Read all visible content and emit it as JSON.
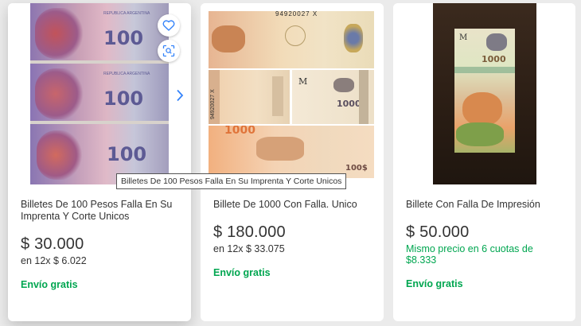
{
  "listings": [
    {
      "title": "Billetes De 100 Pesos Falla En Su Imprenta Y Corte Unicos",
      "price": "$ 30.000",
      "installments": "en 12x $ 6.022",
      "shipping": "Envío gratis",
      "image_text": {
        "note_value": "100",
        "bank_label": "REPUBLICA ARGENTINA"
      }
    },
    {
      "title": "Billete De 1000 Con Falla. Unico",
      "price": "$ 180.000",
      "installments": "en 12x $ 33.075",
      "shipping": "Envío gratis",
      "image_text": {
        "serial": "94920027 X",
        "serial_vertical": "94920027 X",
        "note_letter": "M",
        "note_value_a": "1000",
        "note_value_b": "1000",
        "note_value_c": "100$"
      }
    },
    {
      "title": "Billete Con Falla De Impresión",
      "price": "$ 50.000",
      "installments": "Mismo precio en 6 cuotas de $8.333",
      "shipping": "Envío gratis",
      "image_text": {
        "note_letter": "M",
        "note_value": "1000"
      }
    }
  ],
  "tooltip": "Billetes De 100 Pesos Falla En Su Imprenta Y Corte Unicos",
  "icons": {
    "favorite": "heart-icon",
    "visual_search": "visual-search-icon",
    "next": "chevron-right-icon"
  },
  "colors": {
    "price_text": "#333333",
    "shipping_green": "#00a650",
    "icon_blue": "#3483fa",
    "background": "#ebebeb"
  }
}
